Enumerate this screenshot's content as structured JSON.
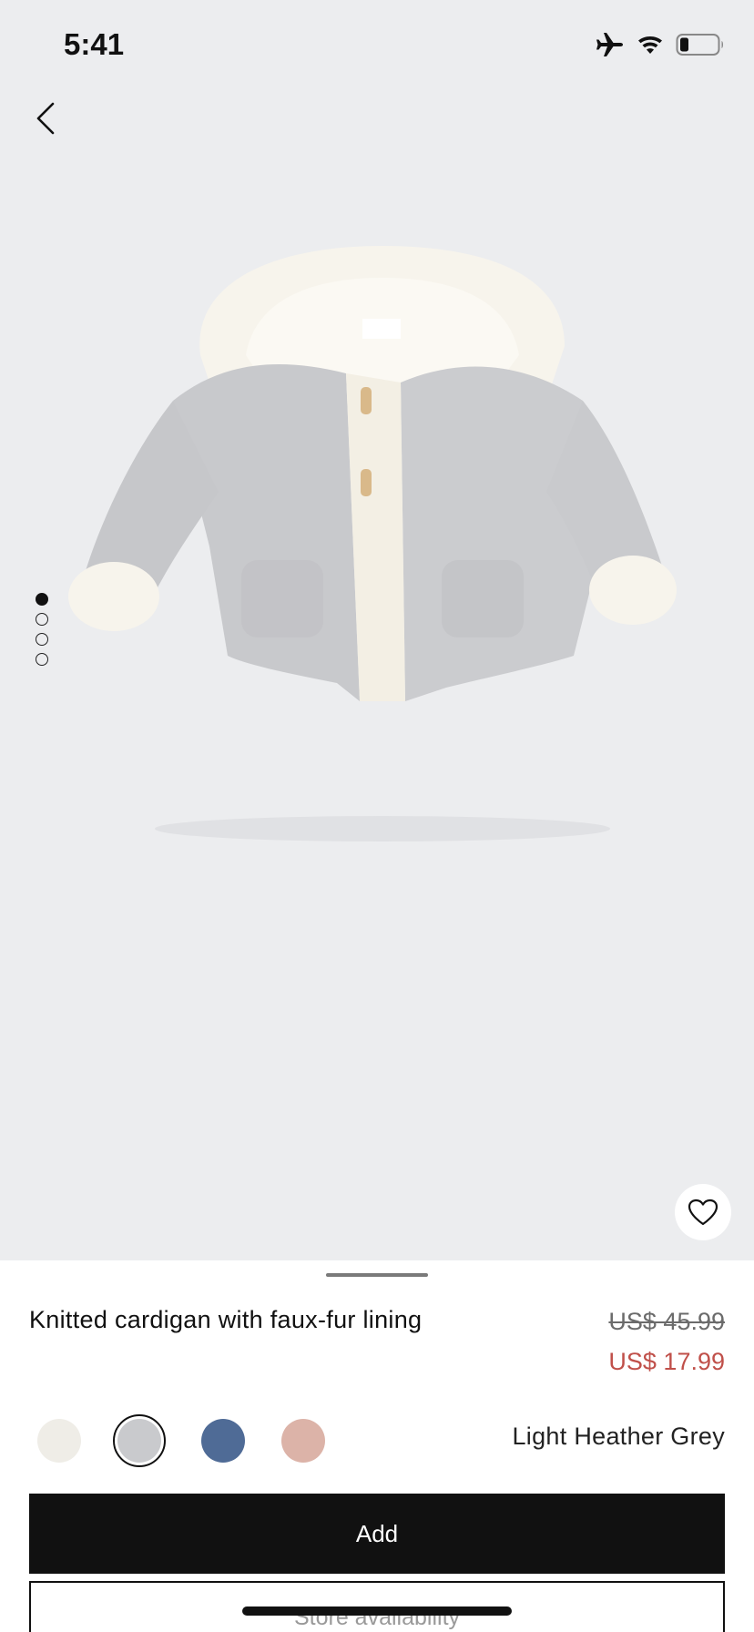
{
  "status_bar": {
    "time": "5:41",
    "icons": [
      "airplane-icon",
      "wifi-icon",
      "battery-icon"
    ]
  },
  "gallery": {
    "image_count": 4,
    "active_index": 0,
    "image_description_icon": "hooded-knit-cardigan-image"
  },
  "product": {
    "title": "Knitted cardigan with faux-fur lining",
    "price_original": "US$ 45.99",
    "price_sale": "US$ 17.99"
  },
  "colors": {
    "selected_name": "Light Heather Grey",
    "swatches": [
      {
        "name": "off-white",
        "hex": "#efede7"
      },
      {
        "name": "light-heather-grey",
        "hex": "#c9cacd",
        "selected": true
      },
      {
        "name": "blue",
        "hex": "#4f6b96"
      },
      {
        "name": "pink",
        "hex": "#dcb3a8"
      }
    ]
  },
  "actions": {
    "add_label": "Add",
    "store_label": "Store availability"
  },
  "theme": {
    "sale_color": "#c0504a",
    "hero_background": "#ecedef",
    "primary_button": "#111111"
  }
}
